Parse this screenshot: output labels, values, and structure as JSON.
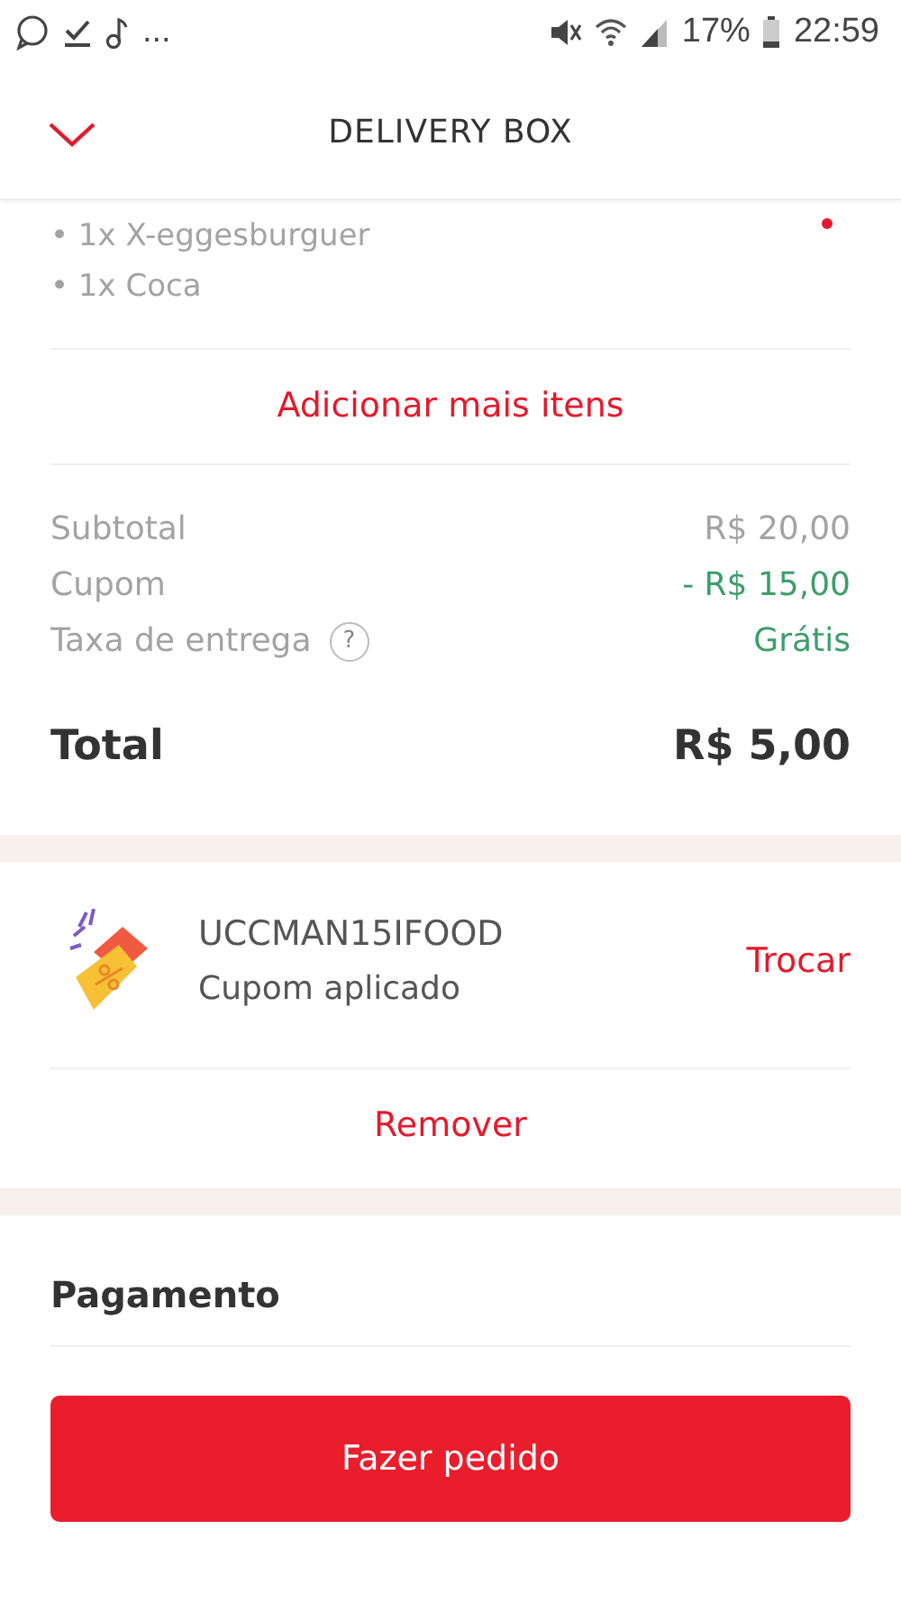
{
  "status_bar": {
    "more": "...",
    "battery": "17%",
    "time": "22:59"
  },
  "header": {
    "title": "DELIVERY BOX"
  },
  "order_items": [
    "• 1x X-eggesburguer",
    "• 1x Coca"
  ],
  "add_more": "Adicionar mais itens",
  "summary": [
    {
      "label": "Subtotal",
      "value": "R$ 20,00",
      "kind": "plain",
      "help": false
    },
    {
      "label": "Cupom",
      "value": "- R$ 15,00",
      "kind": "discount",
      "help": false
    },
    {
      "label": "Taxa de entrega",
      "value": "Grátis",
      "kind": "discount",
      "help": true
    }
  ],
  "help_mark": "?",
  "total": {
    "label": "Total",
    "value": "R$ 5,00"
  },
  "coupon": {
    "code": "UCCMAN15IFOOD",
    "status": "Cupom aplicado",
    "change": "Trocar",
    "remove": "Remover"
  },
  "payment": {
    "title": "Pagamento"
  },
  "submit": "Fazer pedido"
}
